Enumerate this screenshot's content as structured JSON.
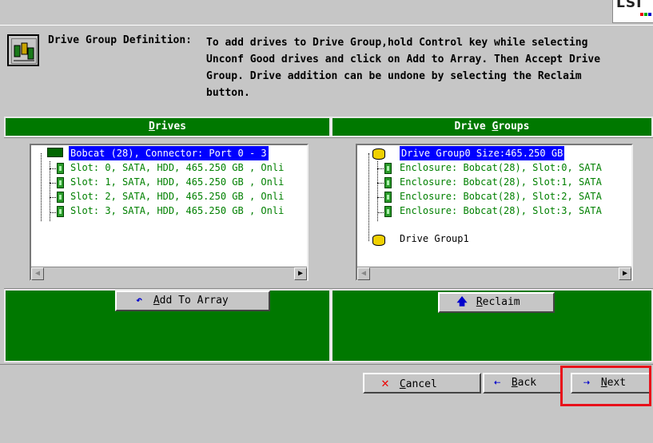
{
  "brand": {
    "logo_text": "LSI"
  },
  "instructions": {
    "title": "Drive Group Definition:",
    "body": "To add drives to Drive Group,hold Control key while selecting\nUnconf Good drives and click on Add to Array. Then Accept Drive\nGroup. Drive addition can be undone by selecting the Reclaim\nbutton."
  },
  "drives_panel": {
    "header_prefix": "",
    "header_key": "D",
    "header_rest": "rives",
    "root": "Bobcat (28), Connector: Port 0 - 3",
    "items": [
      "Slot: 0, SATA, HDD, 465.250 GB , Onli",
      "Slot: 1, SATA, HDD, 465.250 GB , Onli",
      "Slot: 2, SATA, HDD, 465.250 GB , Onli",
      "Slot: 3, SATA, HDD, 465.250 GB , Onli"
    ],
    "add_button_key": "A",
    "add_button_rest": "dd To Array"
  },
  "groups_panel": {
    "header_prefix": "Drive ",
    "header_key": "G",
    "header_rest": "roups",
    "group0": "Drive Group0  Size:465.250 GB",
    "items": [
      "Enclosure: Bobcat(28), Slot:0, SATA",
      "Enclosure: Bobcat(28), Slot:1, SATA",
      "Enclosure: Bobcat(28), Slot:2, SATA",
      "Enclosure: Bobcat(28), Slot:3, SATA"
    ],
    "group1": "Drive Group1",
    "reclaim_key": "R",
    "reclaim_rest": "eclaim"
  },
  "nav": {
    "cancel_key": "C",
    "cancel_rest": "ancel",
    "back_key": "B",
    "back_rest": "ack",
    "next_key": "N",
    "next_rest": "ext"
  },
  "colors": {
    "panel_green": "#007800",
    "selection_blue": "#0000ff",
    "tree_text_green": "#008000",
    "highlight_red": "#e8101a"
  },
  "icons": {
    "definition": "drive-group-definition-icon",
    "add": "undo-arrow-icon",
    "reclaim": "up-arrow-icon",
    "cancel": "red-x-icon",
    "back": "left-arrow-icon",
    "next": "right-arrow-icon"
  }
}
